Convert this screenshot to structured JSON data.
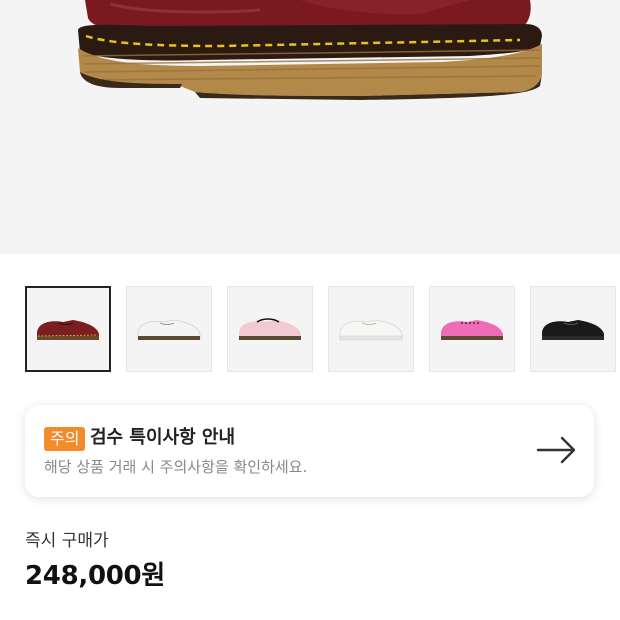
{
  "product_image": {
    "alt": "hero-shoe",
    "color": "#7a1a1f"
  },
  "gallery": {
    "selected_index": 0,
    "thumbnails": [
      {
        "name": "thumbnail-cherry-red",
        "color": "#7a1e22",
        "welt": "#c9a84a"
      },
      {
        "name": "thumbnail-white",
        "color": "#f2f2f2",
        "welt": "#6b5a3a"
      },
      {
        "name": "thumbnail-pale-pink",
        "color": "#f3c9d3",
        "welt": "#6b5a3a"
      },
      {
        "name": "thumbnail-white-mono",
        "color": "#f4f4f2",
        "welt": "#e8e8e6"
      },
      {
        "name": "thumbnail-hot-pink",
        "color": "#ef6bb6",
        "welt": "#6b5a3a"
      },
      {
        "name": "thumbnail-black",
        "color": "#1a1a1a",
        "welt": "#2a2a2a"
      }
    ]
  },
  "notice": {
    "badge": "주의",
    "title": "검수 특이사항 안내",
    "description": "해당 상품 거래 시 주의사항을 확인하세요.",
    "badge_color": "#f28b2a"
  },
  "price": {
    "label": "즉시 구매가",
    "value": "248,000원"
  }
}
